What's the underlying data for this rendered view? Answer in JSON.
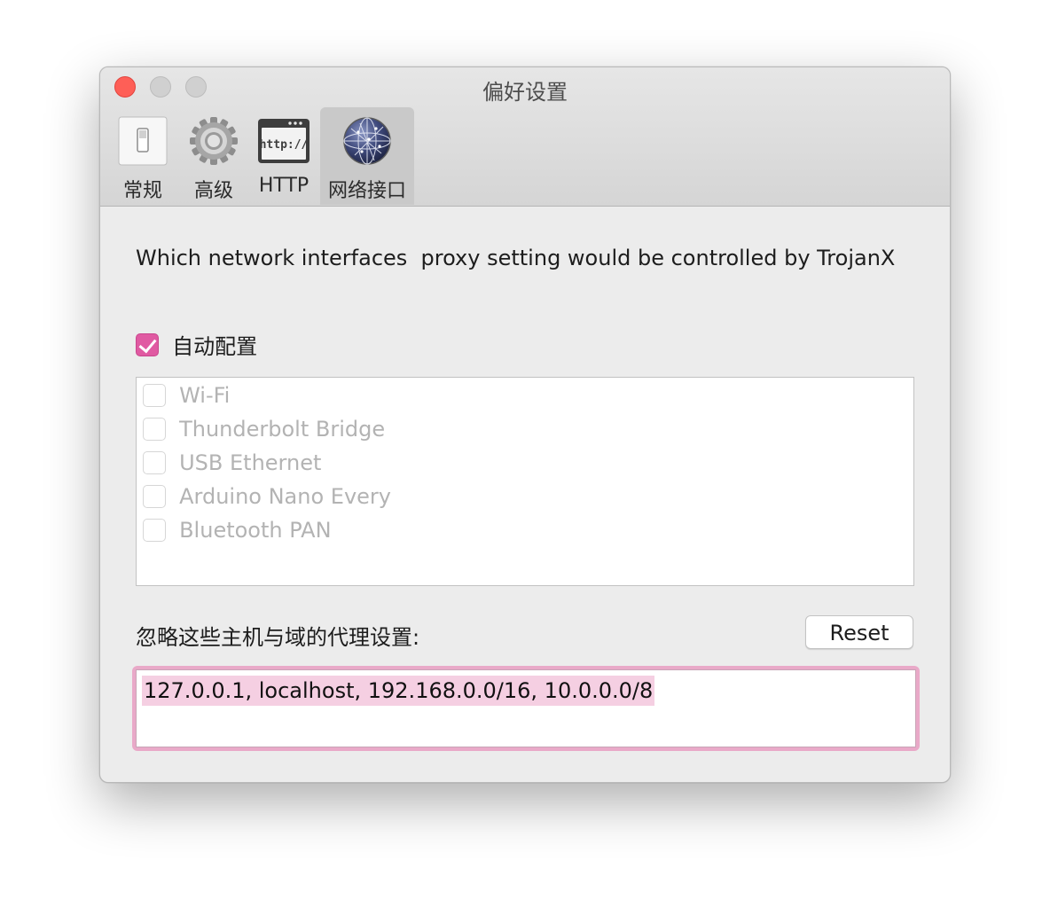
{
  "window": {
    "title": "偏好设置"
  },
  "toolbar": {
    "tabs": [
      {
        "label": "常规",
        "icon": "switch-icon"
      },
      {
        "label": "高级",
        "icon": "gear-icon"
      },
      {
        "label": "HTTP",
        "icon": "http-window-icon"
      },
      {
        "label": "网络接口",
        "icon": "network-globe-icon",
        "selected": true
      }
    ]
  },
  "content": {
    "description": "Which network interfaces  proxy setting would be controlled by TrojanX",
    "auto_config": {
      "label": "自动配置",
      "checked": true
    },
    "interfaces": [
      {
        "label": "Wi-Fi",
        "checked": false
      },
      {
        "label": "Thunderbolt Bridge",
        "checked": false
      },
      {
        "label": "USB Ethernet",
        "checked": false
      },
      {
        "label": "Arduino Nano Every",
        "checked": false
      },
      {
        "label": "Bluetooth PAN",
        "checked": false
      }
    ],
    "bypass": {
      "label": "忽略这些主机与域的代理设置:",
      "value": "127.0.0.1, localhost, 192.168.0.0/16, 10.0.0.0/8",
      "reset_label": "Reset"
    }
  },
  "colors": {
    "accent": "#e05aa2",
    "focus_ring": "#e9a9c8",
    "selection": "#f5cfe2",
    "close_button": "#fe5f57"
  }
}
